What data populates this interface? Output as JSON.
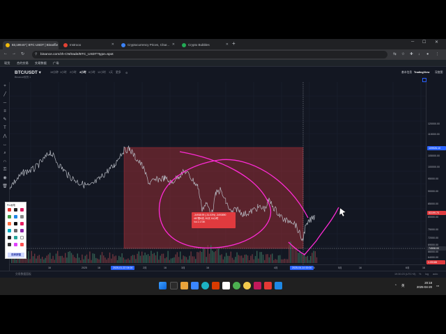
{
  "browser": {
    "tabs": [
      {
        "label": "83,199.67 | BTC USDT | Binance",
        "active": true,
        "favicon_color": "#f0b90b"
      },
      {
        "label": "Instrooo",
        "active": false,
        "favicon_color": "#e34234"
      },
      {
        "label": "Cryptocurrency Prices, Char...",
        "active": false,
        "favicon_color": "#3b82f6"
      },
      {
        "label": "Crypto Bubbles",
        "active": false,
        "favicon_color": "#22aa55"
      }
    ],
    "url": "binance.com/zh-CN/trade/BTC_USDT?type=spot"
  },
  "site_nav": [
    "现货",
    "合约交易",
    "交易数据",
    "广场"
  ],
  "chart_header": {
    "pair": "BTC/USDT",
    "exchange": "Binance现货 1",
    "timeframes": [
      "15分钟",
      "1小时",
      "2小时",
      "4小时",
      "6小时",
      "12小时",
      "1天",
      "更多"
    ],
    "active_timeframe": "4小时",
    "right_links": [
      "基本信息",
      "TradingView",
      "深度图"
    ]
  },
  "price_axis": {
    "labels": [
      "120000.00",
      "115000.00",
      "105000.00",
      "100000.00",
      "95000.00",
      "90000.00",
      "85000.00",
      "80000.00",
      "75000.00",
      "72000.00",
      "69000.00",
      "66000.00",
      "64000.00",
      "62000.00",
      "60000.00"
    ],
    "tags": [
      {
        "label": "109926.10",
        "color": "#2962ff"
      },
      {
        "label": "83199.70",
        "color": "#e03a3e"
      },
      {
        "label": "74508.00",
        "color": "#2a2e39"
      },
      {
        "label": "1.05188",
        "color": "#e03a3e"
      }
    ]
  },
  "time_axis": {
    "labels": [
      "16",
      "2025",
      "16",
      "2月",
      "16",
      "3月",
      "16",
      "4月",
      "16",
      "5月",
      "16",
      "6月",
      "16"
    ],
    "tags": [
      "2025-01-22 04:00",
      "2025-04-14 00:00"
    ]
  },
  "tooltip": {
    "line1": "-34938.99 (-31.03%) -3493890",
    "line2": "487根K线, 81天 16小时",
    "line3": "Vol 2.173K"
  },
  "palette": {
    "title": "Pro画笔",
    "label": "去掉按钮",
    "colors": [
      "#e53935",
      "#222222",
      "#d81b60",
      "#43a047",
      "#1e88e5",
      "#888888",
      "#ff7043",
      "#111111",
      "#e91e63",
      "#00acc1",
      "#666666",
      "#8e24aa",
      "#222222",
      "#26a69a",
      "#ffffff",
      "#333333",
      "#e040fb",
      "#ff5252"
    ]
  },
  "bottom_bar": {
    "left": "交易数据面板",
    "right_info": "19:30:23 (UTC+8)",
    "right_items": [
      "%",
      "log",
      "auto"
    ]
  },
  "taskbar": {
    "time": "20:18",
    "date": "2025-04-20",
    "lang": "英"
  },
  "colors": {
    "background": "#131722",
    "range_box": "#e03a3e",
    "annotation": "#ff2bd6",
    "candle_line": "#b8bcc4"
  }
}
